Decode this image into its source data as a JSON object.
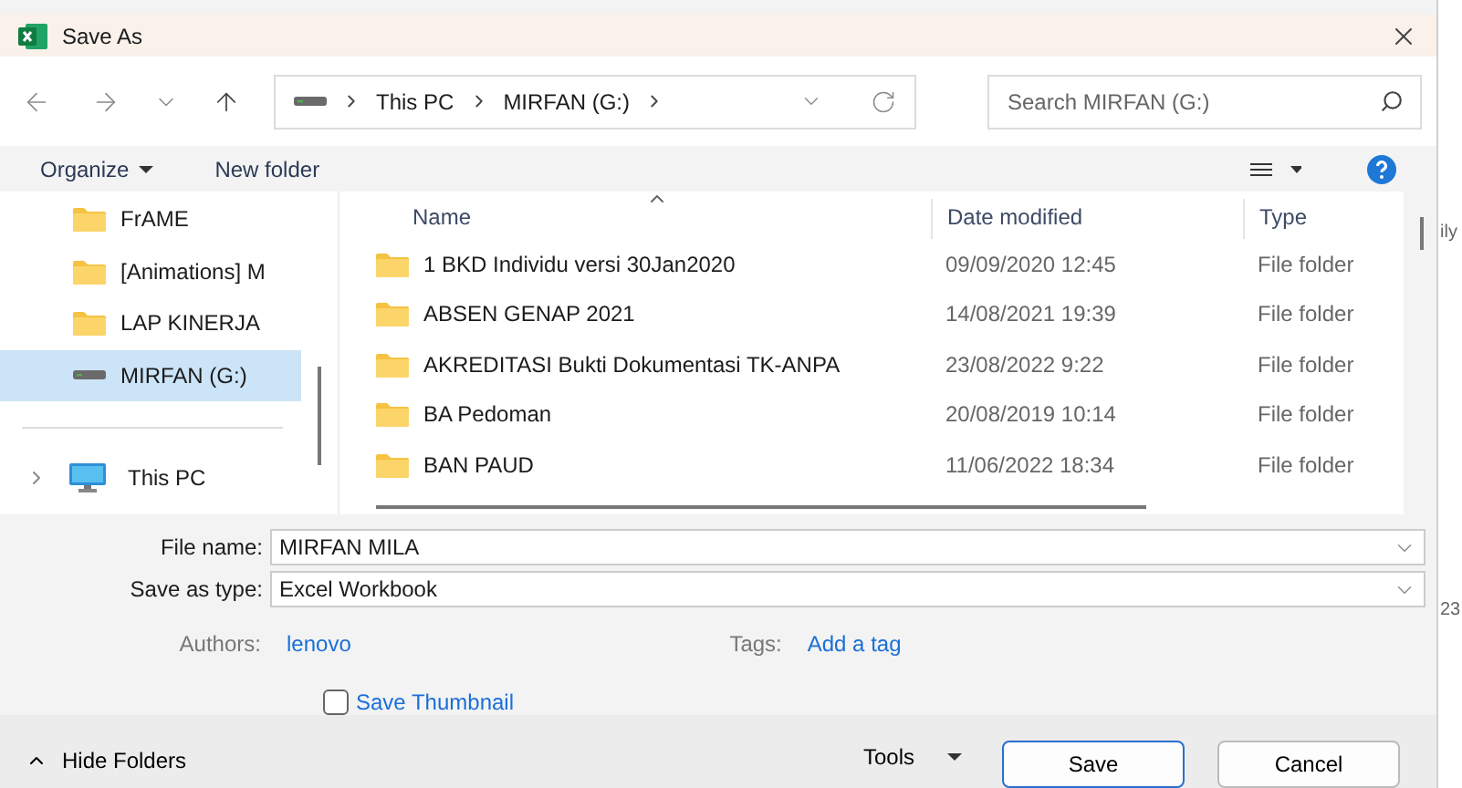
{
  "window": {
    "title": "Save As"
  },
  "nav": {
    "breadcrumb": [
      "This PC",
      "MIRFAN (G:)"
    ],
    "search": {
      "placeholder": "Search MIRFAN (G:)"
    }
  },
  "toolbar": {
    "organize": "Organize",
    "new_folder": "New folder"
  },
  "sidebar": {
    "items": [
      {
        "label": "FrAME",
        "kind": "folder",
        "selected": false
      },
      {
        "label": "[Animations] M",
        "kind": "folder",
        "selected": false
      },
      {
        "label": "LAP KINERJA",
        "kind": "folder",
        "selected": false
      },
      {
        "label": "MIRFAN (G:)",
        "kind": "drive",
        "selected": true
      }
    ],
    "this_pc": {
      "label": "This PC",
      "expanded": false
    }
  },
  "table": {
    "columns": [
      "Name",
      "Date modified",
      "Type"
    ],
    "rows": [
      {
        "name": "1 BKD Individu versi 30Jan2020",
        "date": "09/09/2020 12:45",
        "type": "File folder"
      },
      {
        "name": "ABSEN GENAP 2021",
        "date": "14/08/2021 19:39",
        "type": "File folder"
      },
      {
        "name": "AKREDITASI Bukti Dokumentasi TK-ANPA",
        "date": "23/08/2022 9:22",
        "type": "File folder"
      },
      {
        "name": "BA Pedoman",
        "date": "20/08/2019 10:14",
        "type": "File folder"
      },
      {
        "name": "BAN PAUD",
        "date": "11/06/2022 18:34",
        "type": "File folder"
      }
    ]
  },
  "form": {
    "fields": [
      {
        "label": "File name:",
        "value": "MIRFAN MILA"
      },
      {
        "label": "Save as type:",
        "value": "Excel Workbook"
      }
    ],
    "authors_label": "Authors:",
    "authors": "lenovo",
    "tags_label": "Tags:",
    "tags": "Add a tag",
    "save_thumbnail": {
      "label": "Save Thumbnail",
      "checked": false
    }
  },
  "footer": {
    "hide_folders": "Hide Folders",
    "tools": "Tools",
    "buttons": [
      "Save",
      "Cancel"
    ]
  },
  "background": {
    "texts": [
      "ily",
      "23"
    ]
  }
}
